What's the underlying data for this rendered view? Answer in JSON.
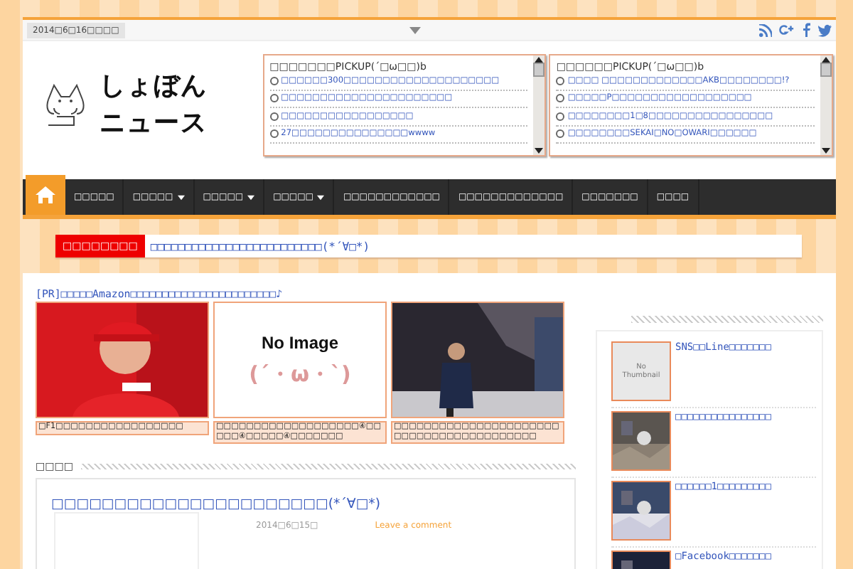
{
  "top_bar": {
    "date": "2014□6□16□□□□"
  },
  "logo": {
    "line1": "しょぼん",
    "line2": "ニュース"
  },
  "pickups": [
    {
      "title": "□□□□□□□PICKUP(´□ω□□)b",
      "items": [
        "□□□□□□300□□□□□□□□□□□□□□□□□□□□",
        "□□□□□□□□□□□□□□□□□□□□□□",
        "□□□□□□□□□□□□□□□□□",
        "27□□□□□□□□□□□□□□□wwww"
      ]
    },
    {
      "title": "□□□□□□PICKUP(´□ω□□)b",
      "items": [
        "□□□□ □□□□□□□□□□□□□AKB□□□□□□□□!?",
        "□□□□□P□□□□□□□□□□□□□□□□□□",
        "□□□□□□□□1□8□□□□□□□□□□□□□□□□",
        "□□□□□□□□SEKAI□NO□OWARI□□□□□□"
      ]
    }
  ],
  "nav": {
    "items": [
      {
        "label": "□□□□□",
        "dropdown": false
      },
      {
        "label": "□□□□□",
        "dropdown": true
      },
      {
        "label": "□□□□□",
        "dropdown": true
      },
      {
        "label": "□□□□□",
        "dropdown": true
      },
      {
        "label": "□□□□□□□□□□□□",
        "dropdown": false
      },
      {
        "label": "□□□□□□□□□□□□□",
        "dropdown": false
      },
      {
        "label": "□□□□□□□",
        "dropdown": false
      },
      {
        "label": "□□□□",
        "dropdown": false
      }
    ]
  },
  "ticker": {
    "label": "□□□□□□□□",
    "headline": "□□□□□□□□□□□□□□□□□□□□□□□□□(*´∀□*)"
  },
  "pr": {
    "text": "[PR]□□□□□Amazon□□□□□□□□□□□□□□□□□□□□□□□♪"
  },
  "features": [
    {
      "kind": "picture",
      "caption": "□F1□□□□□□□□□□□□□□□□□"
    },
    {
      "kind": "no_image",
      "line1": "No Image",
      "line2": "(´・ω・`)",
      "caption": "□□□□□□□□□□□□□□□□□□□④□□□□□④□□□□□④□□□□□□□"
    },
    {
      "kind": "picture",
      "caption": "□□□□□□□□□□□□□□□□□□□□□□□□□□□□□□□□□□□□□□□□□"
    }
  ],
  "section": {
    "heading": "□□□□"
  },
  "post": {
    "title": "□□□□□□□□□□□□□□□□□□□□□□(*´∀□*)",
    "date": "2014□6□15□",
    "comment": "Leave a comment"
  },
  "sidebar": {
    "items": [
      {
        "kind": "no_thumbnail",
        "thumb_text": "No Thumbnail",
        "title": "SNS□□Line□□□□□□□"
      },
      {
        "kind": "picture",
        "title": "□□□□□□□□□□□□□□□□"
      },
      {
        "kind": "picture",
        "title": "□□□□□□1□□□□□□□□□"
      },
      {
        "kind": "picture",
        "title": "□Facebook□□□□□□□"
      }
    ]
  }
}
